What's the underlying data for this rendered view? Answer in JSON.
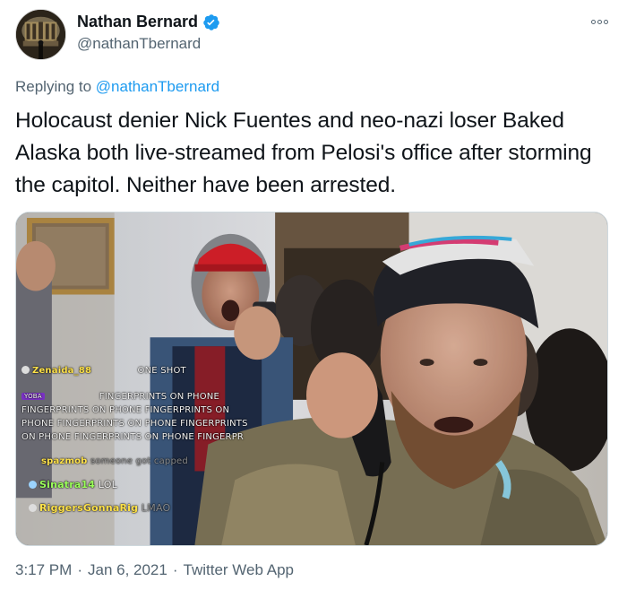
{
  "author": {
    "display_name": "Nathan Bernard",
    "handle": "@nathanTbernard",
    "verified": true
  },
  "reply": {
    "prefix": "Replying to",
    "to_handle": "@nathanTbernard"
  },
  "tweet": {
    "text": "Holocaust denier Nick Fuentes and neo-nazi loser Baked Alaska both live-streamed from Pelosi's office after storming the capitol. Neither have been arrested."
  },
  "media": {
    "chat": [
      {
        "user": "Zenaida_88",
        "message": "ONE SHOT"
      },
      {
        "user": "YOBA",
        "message": "FINGERPRINTS ON PHONE"
      },
      {
        "user": "",
        "message": "FINGERPRINTS ON PHONE FINGERPRINTS ON"
      },
      {
        "user": "",
        "message": "PHONE FINGERPRINTS ON PHONE FINGERPRINTS"
      },
      {
        "user": "",
        "message": "ON PHONE FINGERPRINTS ON PHONE FINGERPR"
      },
      {
        "user": "spazmob",
        "message": "someone got capped"
      },
      {
        "user": "Sinatra14",
        "message": "LOL"
      },
      {
        "user": "RiggersGonnaRig",
        "message": "LMAO"
      }
    ]
  },
  "meta": {
    "time": "3:17 PM",
    "date": "Jan 6, 2021",
    "source": "Twitter Web App",
    "separator": "·"
  },
  "colors": {
    "link": "#1d9bf0",
    "secondary_text": "#536471",
    "primary_text": "#0f1419",
    "verified_badge": "#1d9bf0"
  },
  "icons": {
    "verified": "verified-badge-icon",
    "more": "more-options-icon"
  }
}
